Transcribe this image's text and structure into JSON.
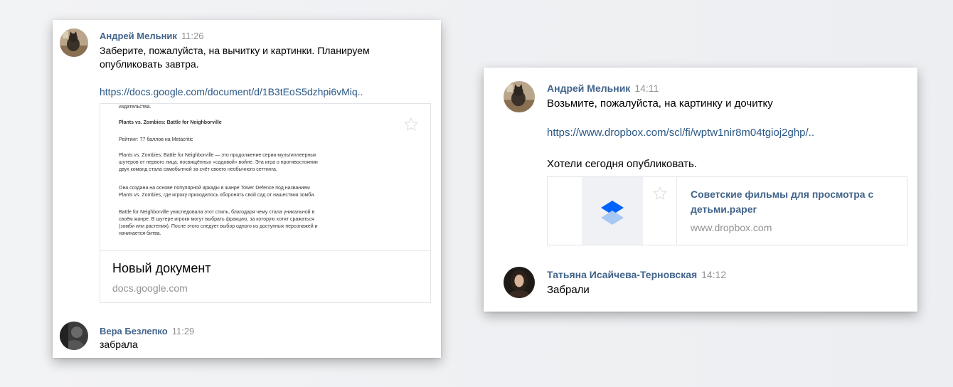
{
  "left_chat": {
    "messages": [
      {
        "author": "Андрей Мельник",
        "time": "11:26",
        "text_line1": "Заберите, пожалуйста, на вычитку и картинки. Планируем",
        "text_line2": "опубликовать завтра.",
        "link": "https://docs.google.com/document/d/1B3tEoS5dzhpi6vMiq..",
        "attachment": {
          "doc_lines": [
            "издательства.",
            "Plants vs. Zombies: Battle for Neighborville",
            "Рейтинг: 77 баллов на Metacritic",
            "Plants vs. Zombies: Battle for Neighborville — это продолжение серии мультиплеерных",
            "шутеров от первого лица, посвящённых «садовой» войне. Эта игра о противостоянии",
            "двух команд стала самобытной за счёт своего необычного сеттинга.",
            "Она создана на основе популярной аркады в жанре Tower Defence под названием",
            "Plants vs. Zombies, где игроку приходилось оборонять свой сад от нашествия зомби.",
            "Battle for Neighborville унаследовала этот стиль, благодаря чему стала уникальной в",
            "своём жанре. В шутере игроки могут выбрать фракцию, за которую хотят сражаться",
            "(зомби или растения). После этого следует выбор одного из доступных персонажей и",
            "начинается битва."
          ],
          "title": "Новый документ",
          "domain": "docs.google.com"
        }
      },
      {
        "author": "Вера Безлепко",
        "time": "11:29",
        "text": "забрала"
      }
    ]
  },
  "right_chat": {
    "messages": [
      {
        "author": "Андрей Мельник",
        "time": "14:11",
        "text": "Возьмите, пожалуйста, на картинку и дочитку",
        "link": "https://www.dropbox.com/scl/fi/wptw1nir8m04tgioj2ghp/..",
        "text2": "Хотели сегодня опубликовать.",
        "attachment": {
          "title_line1": "Советские фильмы для просмотра с",
          "title_line2": "детьми.paper",
          "domain": "www.dropbox.com"
        }
      },
      {
        "author": "Татьяна Исайчева-Терновская",
        "time": "14:12",
        "text": "Забрали"
      }
    ]
  },
  "colors": {
    "author_name": "#42648b",
    "link": "#2a5885",
    "time": "#939393",
    "dropbox_blue": "#0061fe"
  }
}
